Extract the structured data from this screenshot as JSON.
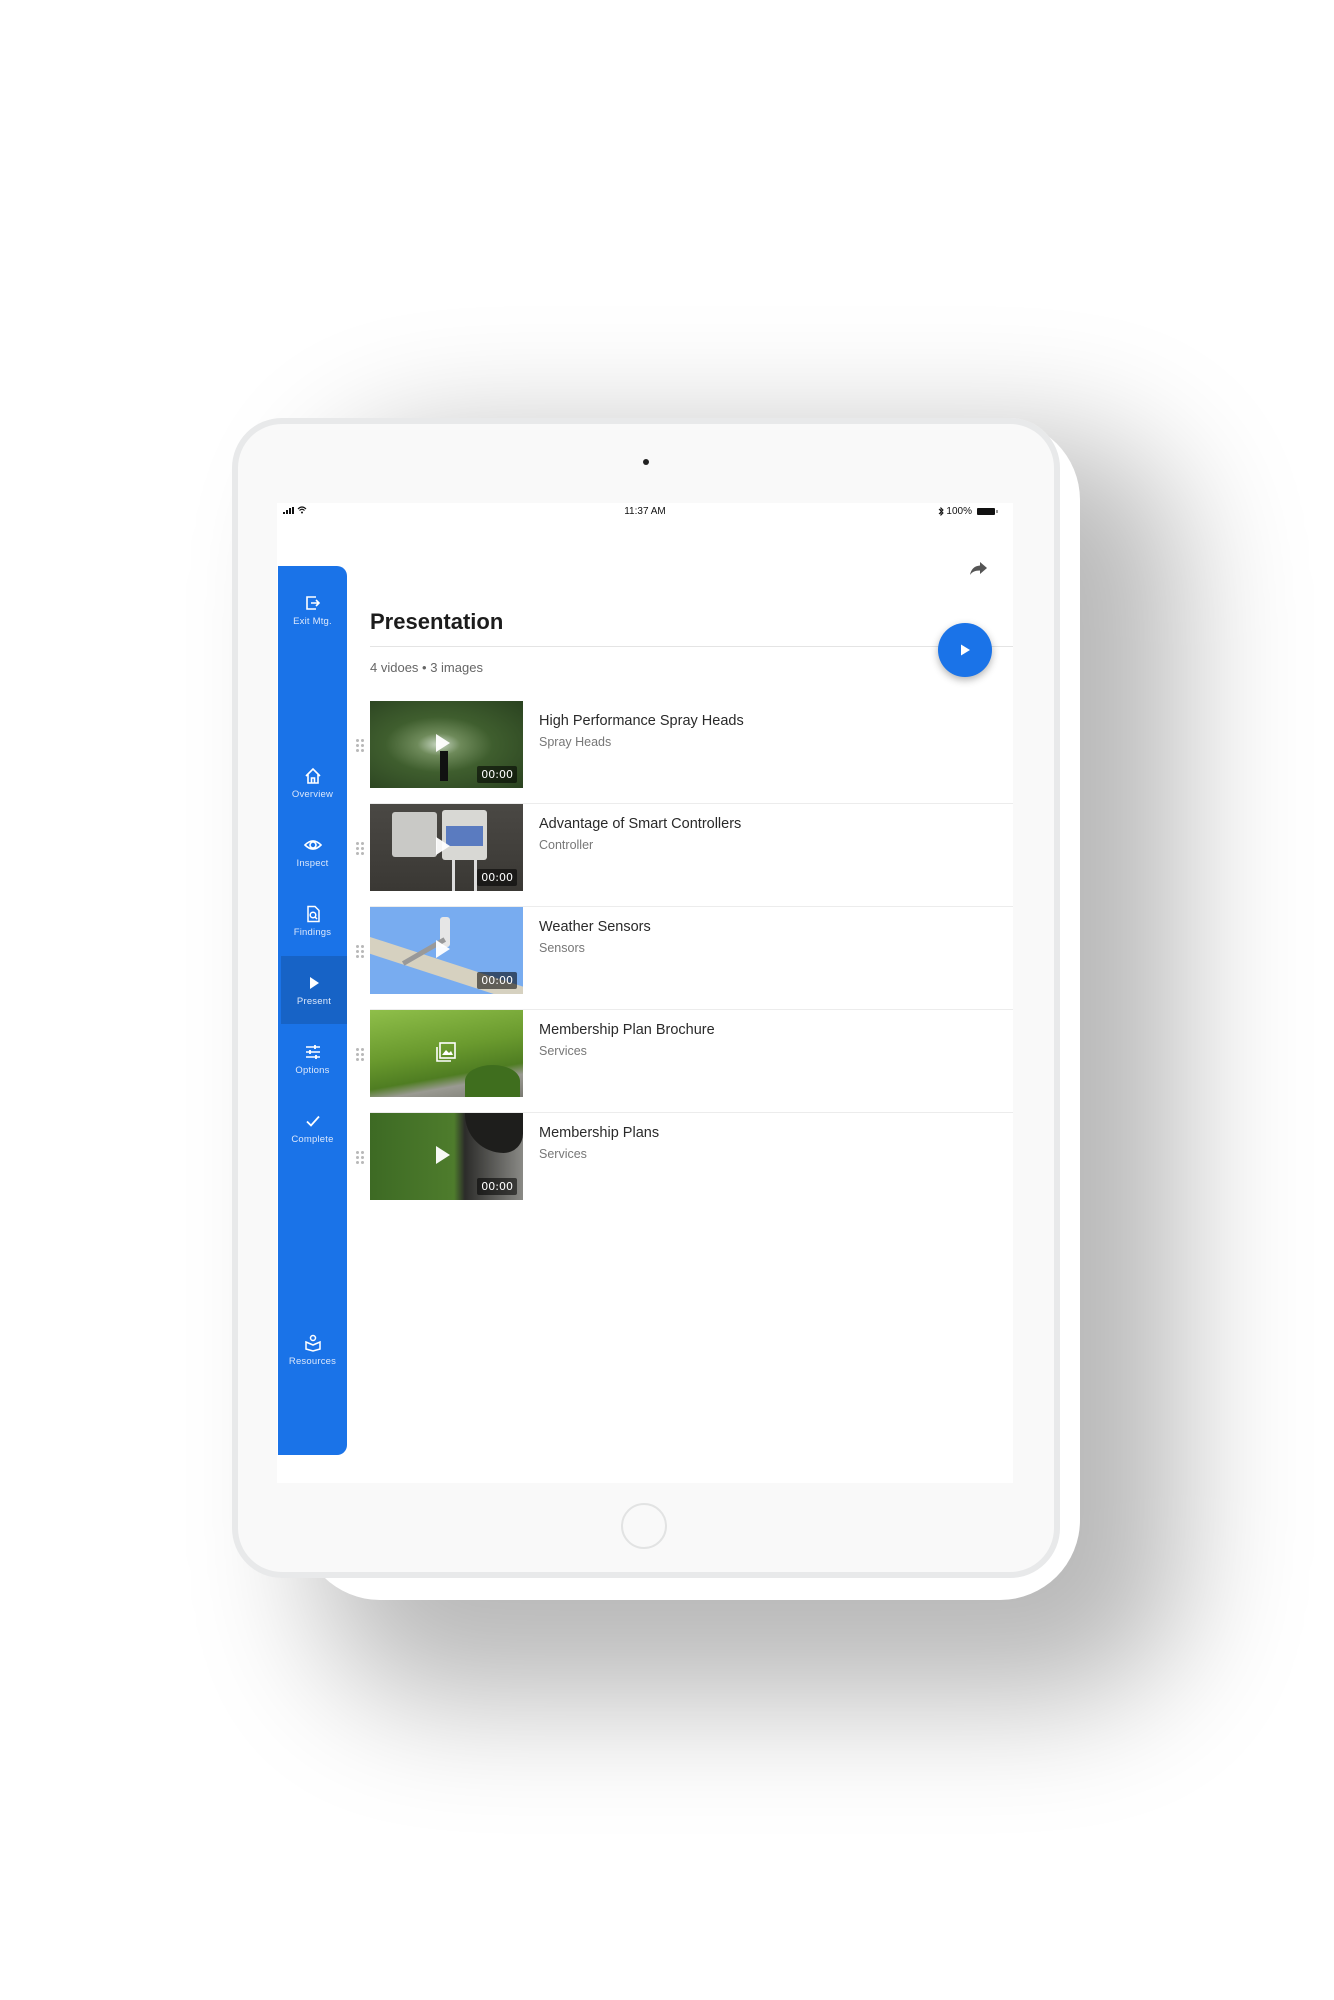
{
  "status_bar": {
    "time": "11:37 AM",
    "battery": "100%",
    "icons": [
      "signal-icon",
      "wifi-icon",
      "bluetooth-icon",
      "battery-icon"
    ]
  },
  "sidebar": {
    "top_item": {
      "label": "Exit Mtg.",
      "icon": "exit-icon"
    },
    "items": [
      {
        "label": "Overview",
        "icon": "home-icon"
      },
      {
        "label": "Inspect",
        "icon": "eye-icon"
      },
      {
        "label": "Findings",
        "icon": "document-search-icon"
      },
      {
        "label": "Present",
        "icon": "play-icon",
        "active": true
      },
      {
        "label": "Options",
        "icon": "sliders-icon"
      },
      {
        "label": "Complete",
        "icon": "check-icon"
      }
    ],
    "bottom_item": {
      "label": "Resources",
      "icon": "book-reader-icon"
    }
  },
  "header": {
    "share_icon": "share-icon",
    "title": "Presentation",
    "summary": "4 vidoes • 3 images",
    "fab_icon": "play-icon"
  },
  "list": [
    {
      "title": "High Performance Spray Heads",
      "subtitle": "Spray Heads",
      "type": "video",
      "duration": "00:00"
    },
    {
      "title": "Advantage of Smart Controllers",
      "subtitle": "Controller",
      "type": "video",
      "duration": "00:00"
    },
    {
      "title": "Weather Sensors",
      "subtitle": "Sensors",
      "type": "video",
      "duration": "00:00"
    },
    {
      "title": "Membership Plan Brochure",
      "subtitle": "Services",
      "type": "image"
    },
    {
      "title": "Membership Plans",
      "subtitle": "Services",
      "type": "video",
      "duration": "00:00"
    }
  ],
  "colors": {
    "primary": "#1a73e8",
    "sidebar_active": "#1763c6"
  }
}
